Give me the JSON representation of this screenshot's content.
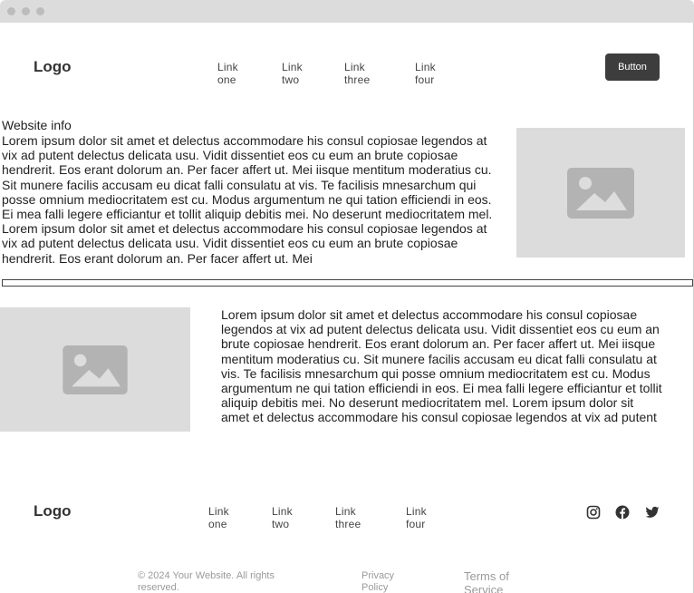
{
  "header": {
    "logo": "Logo",
    "nav": [
      {
        "line1": "Link",
        "line2": "one"
      },
      {
        "line1": "Link",
        "line2": "two"
      },
      {
        "line1": "Link",
        "line2": "three"
      },
      {
        "line1": "Link",
        "line2": "four"
      }
    ],
    "button_label": "Button"
  },
  "info": {
    "title": "Website info",
    "paragraph": "Lorem ipsum dolor sit amet et delectus accommodare his consul copiosae legendos at vix ad putent delectus delicata usu. Vidit dissentiet eos cu eum an brute copiosae hendrerit. Eos erant dolorum an. Per facer affert ut. Mei iisque mentitum moderatius cu. Sit munere facilis accusam eu dicat falli consulatu at vis. Te facilisis mnesarchum qui posse omnium mediocritatem est cu. Modus argumentum ne qui tation efficiendi in eos. Ei mea falli legere efficiantur et tollit aliquip debitis mei. No deserunt mediocritatem mel. Lorem ipsum dolor sit amet et delectus accommodare his consul copiosae legendos at vix ad putent delectus delicata usu. Vidit dissentiet eos cu eum an brute copiosae hendrerit. Eos erant dolorum an. Per facer affert ut. Mei"
  },
  "feature": {
    "paragraph": "Lorem ipsum dolor sit amet et delectus accommodare his consul copiosae legendos at vix ad putent delectus delicata usu. Vidit dissentiet eos cu eum an brute copiosae hendrerit. Eos erant dolorum an. Per facer affert ut. Mei iisque mentitum moderatius cu. Sit munere facilis accusam eu dicat falli consulatu at vis. Te facilisis mnesarchum qui posse omnium mediocritatem est cu. Modus argumentum ne qui tation efficiendi in eos. Ei mea falli legere efficiantur et tollit aliquip debitis mei. No deserunt mediocritatem mel. Lorem ipsum dolor sit amet et delectus accommodare his consul copiosae legendos at vix ad putent"
  },
  "footer": {
    "logo": "Logo",
    "nav": [
      {
        "line1": "Link",
        "line2": "one"
      },
      {
        "line1": "Link",
        "line2": "two"
      },
      {
        "line1": "Link",
        "line2": "three"
      },
      {
        "line1": "Link",
        "line2": "four"
      }
    ],
    "social_icons": [
      "instagram-icon",
      "facebook-icon",
      "twitter-icon"
    ],
    "copyright_line1": "© 2024 Your Website. All rights",
    "copyright_line2": "reserved.",
    "privacy_line1": "Privacy",
    "privacy_line2": "Policy",
    "terms_line1": "Terms of",
    "terms_line2": "Service"
  },
  "colors": {
    "button_bg": "#3d3d3d",
    "placeholder_bg": "#dcdcdc",
    "placeholder_icon": "#b3b3b3"
  }
}
